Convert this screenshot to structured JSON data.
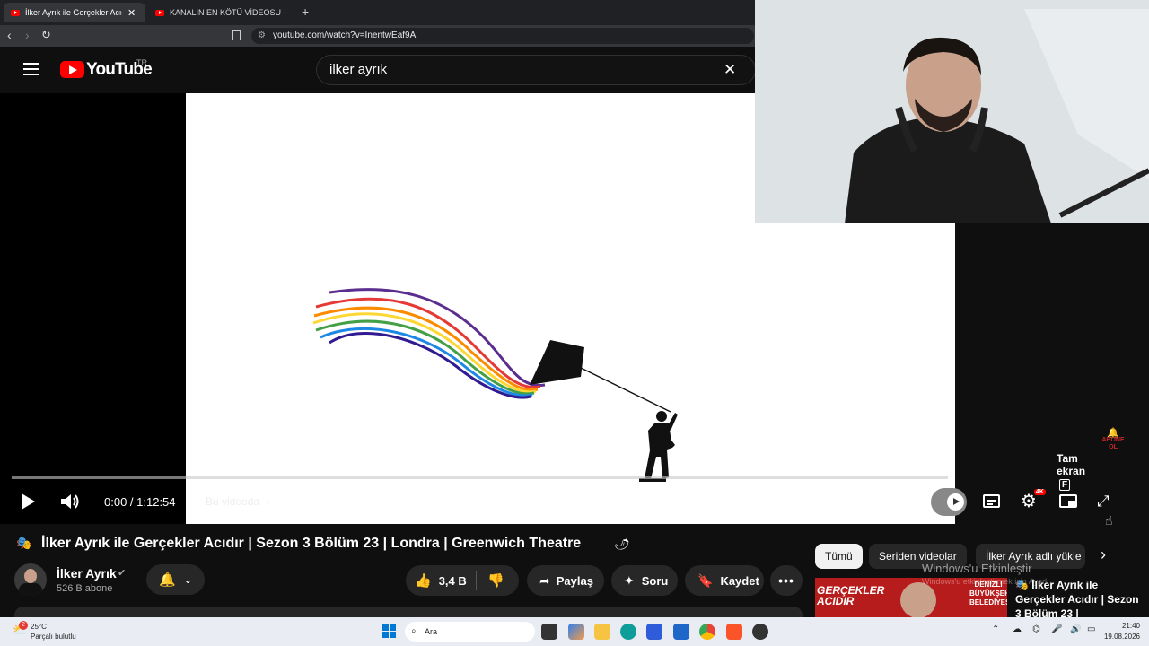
{
  "browser": {
    "tabs": [
      {
        "title": "İlker Ayrık ile Gerçekler Acıdı"
      },
      {
        "title": "KANALIN EN KÖTÜ VİDEOSU - Hama"
      }
    ],
    "url": "youtube.com/watch?v=InentwEaf9A"
  },
  "youtube": {
    "logo_text": "YouTube",
    "region": "TR",
    "search_value": "ilker ayrık"
  },
  "player": {
    "time": "0:00 / 1:12:54",
    "chapter_label": "Bu videoda",
    "tooltip": "Tam ekran",
    "tooltip_key": "F",
    "progress": 0.0,
    "settings_badge": "4K",
    "subscribe_watermark": "ABONE OL"
  },
  "video": {
    "title": "İlker Ayrık ile Gerçekler Acıdır | Sezon 3 Bölüm 23 | Londra | Greenwich Theatre",
    "channel": "İlker Ayrık",
    "subscribers": "526 B abone",
    "likes": "3,4 B",
    "share": "Paylaş",
    "ask": "Soru",
    "save": "Kaydet"
  },
  "sidebar": {
    "chips": [
      "Tümü",
      "Seriden videolar",
      "İlker Ayrık adlı yükle"
    ],
    "activate_title": "Windows'u Etkinleştir",
    "activate_sub": "Windows'u etkinleştirmek için Ayarlar'a gidin",
    "thumb_text": "GERÇEKLER ACIDIR",
    "thumb_sign": "DENİZLİ BÜYÜKŞEHİR BELEDİYESİ",
    "rec_title": "İlker Ayrık ile Gerçekler Acıdır | Sezon 3 Bölüm 23 |"
  },
  "taskbar": {
    "weather_temp": "25°C",
    "weather_desc": "Parçalı bulutlu",
    "weather_badge": "2",
    "search": "Ara",
    "time": "21:40",
    "date": "19.08.2026"
  }
}
